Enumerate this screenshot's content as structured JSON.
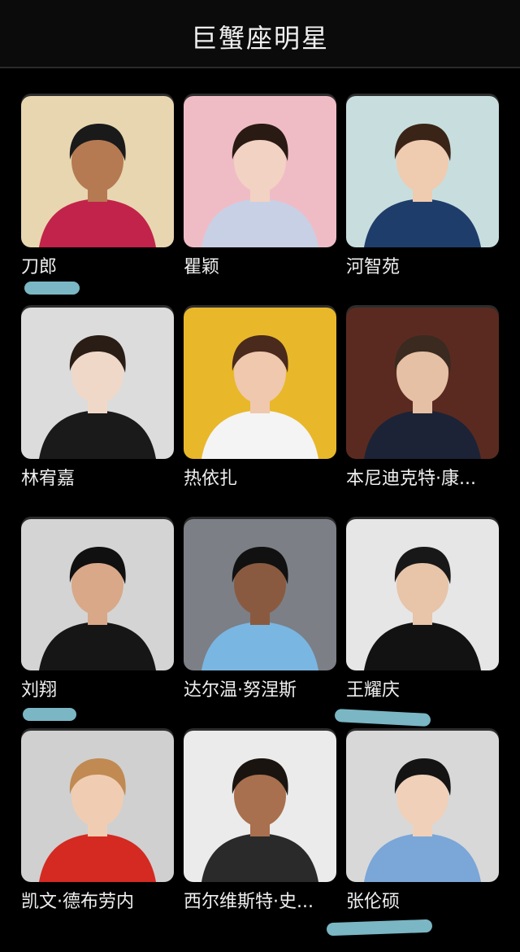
{
  "header": {
    "title": "巨蟹座明星"
  },
  "celebrities": [
    {
      "name": "刀郎",
      "bg": "#e8d6b0",
      "shirt": "#c2234a",
      "hair": "#1a1a1a",
      "skin": "#b57a52"
    },
    {
      "name": "瞿颖",
      "bg": "#efbcc6",
      "shirt": "#c8d0e6",
      "hair": "#2a1a14",
      "skin": "#f2d2c2"
    },
    {
      "name": "河智苑",
      "bg": "#c8dede",
      "shirt": "#1f3d6b",
      "hair": "#3a2418",
      "skin": "#efcbb0"
    },
    {
      "name": "林宥嘉",
      "bg": "#dcdcdc",
      "shirt": "#1a1a1a",
      "hair": "#2a1d16",
      "skin": "#f0d8c8"
    },
    {
      "name": "热依扎",
      "bg": "#e8b82a",
      "shirt": "#f4f4f4",
      "hair": "#4a2a1c",
      "skin": "#efc8ae"
    },
    {
      "name": "本尼迪克特·康...",
      "bg": "#5a2a20",
      "shirt": "#1c2336",
      "hair": "#3a2a20",
      "skin": "#e6c0a4"
    },
    {
      "name": "刘翔",
      "bg": "#d4d4d4",
      "shirt": "#161616",
      "hair": "#101010",
      "skin": "#d8a888"
    },
    {
      "name": "达尔温·努涅斯",
      "bg": "#7c7f86",
      "shirt": "#7ab6e2",
      "hair": "#111111",
      "skin": "#8a5a40"
    },
    {
      "name": "王耀庆",
      "bg": "#e6e6e6",
      "shirt": "#121212",
      "hair": "#181818",
      "skin": "#e8c4a8"
    },
    {
      "name": "凯文·德布劳内",
      "bg": "#d0d0d0",
      "shirt": "#d42a22",
      "hair": "#c08a52",
      "skin": "#f0cdb2"
    },
    {
      "name": "西尔维斯特·史...",
      "bg": "#ebebeb",
      "shirt": "#2a2a2a",
      "hair": "#1a1410",
      "skin": "#a8704e"
    },
    {
      "name": "张伦硕",
      "bg": "#d8d8d8",
      "shirt": "#7aa6d8",
      "hair": "#141414",
      "skin": "#f0d0b8"
    }
  ]
}
